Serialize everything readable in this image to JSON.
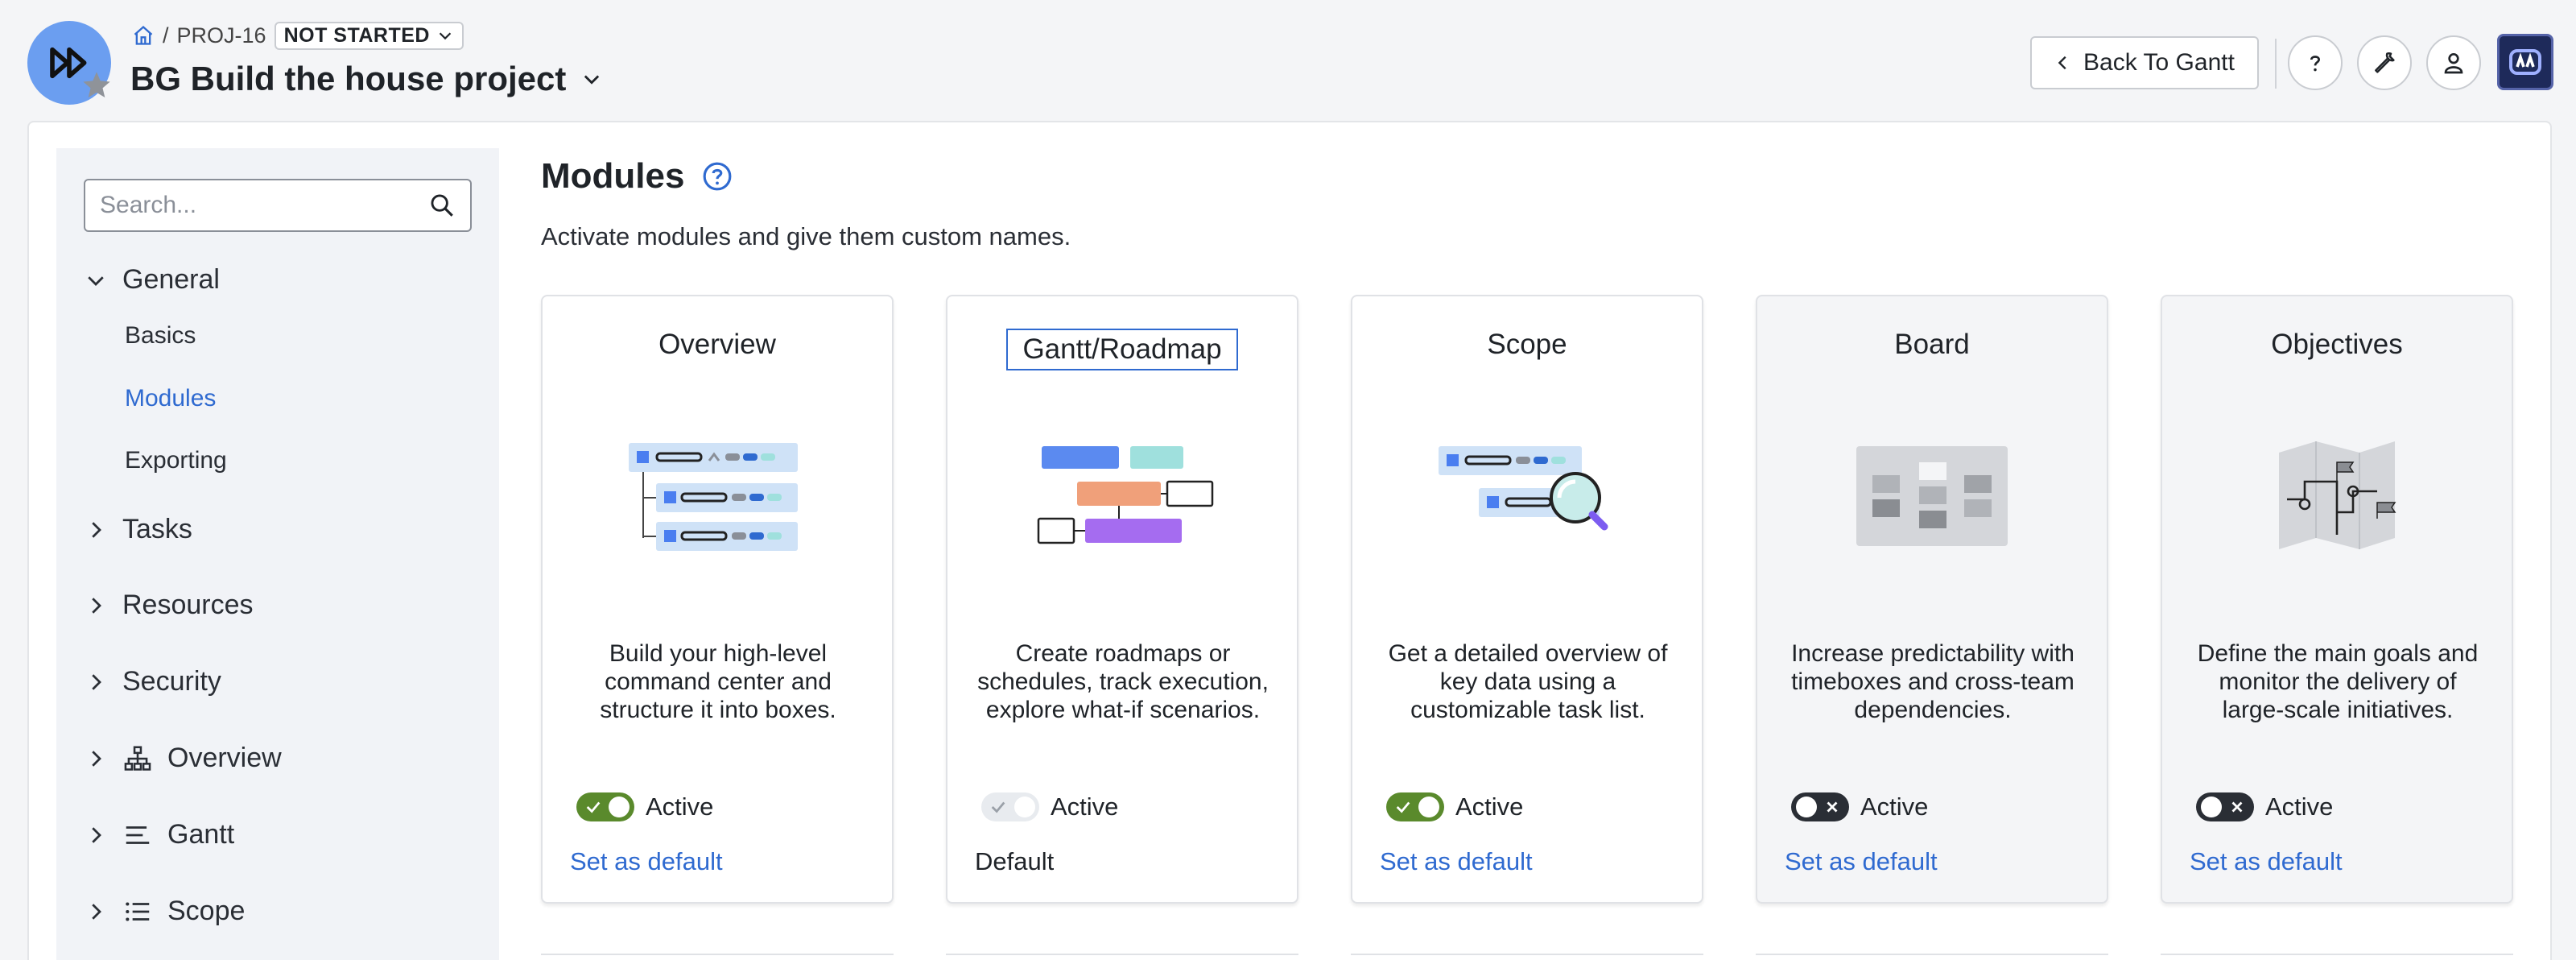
{
  "header": {
    "project_key": "PROJ-16",
    "separator": "/",
    "status": "NOT STARTED",
    "project_title": "BG Build the house project",
    "back_button": "Back To Gantt"
  },
  "sidebar": {
    "search_placeholder": "Search...",
    "general": {
      "label": "General",
      "items": [
        "Basics",
        "Modules",
        "Exporting"
      ]
    },
    "sections": [
      {
        "label": "Tasks"
      },
      {
        "label": "Resources"
      },
      {
        "label": "Security"
      },
      {
        "label": "Overview",
        "icon": "hierarchy-icon"
      },
      {
        "label": "Gantt",
        "icon": "gantt-icon"
      },
      {
        "label": "Scope",
        "icon": "list-icon"
      }
    ]
  },
  "content": {
    "title": "Modules",
    "subtitle": "Activate modules and give them custom names.",
    "cards": [
      {
        "name": "Overview",
        "desc": "Build your high-level command center and structure it into boxes.",
        "toggle": "Active",
        "link": "Set as default"
      },
      {
        "name": "Gantt/Roadmap",
        "desc": "Create roadmaps or schedules, track execution, explore what-if scenarios.",
        "toggle": "Active",
        "link": "Default"
      },
      {
        "name": "Scope",
        "desc": "Get a detailed overview of key data using a customizable task list.",
        "toggle": "Active",
        "link": "Set as default"
      },
      {
        "name": "Board",
        "desc": "Increase predictability with timeboxes and cross-team dependencies.",
        "toggle": "Active",
        "link": "Set as default"
      },
      {
        "name": "Objectives",
        "desc": "Define the main goals and monitor the delivery of large-scale initiatives.",
        "toggle": "Active",
        "link": "Set as default"
      }
    ]
  },
  "colors": {
    "accent": "#2f6ad0",
    "toggle_on": "#5a8a2c",
    "toggle_off": "#2a2e35",
    "logo": "#6b9ef0"
  }
}
